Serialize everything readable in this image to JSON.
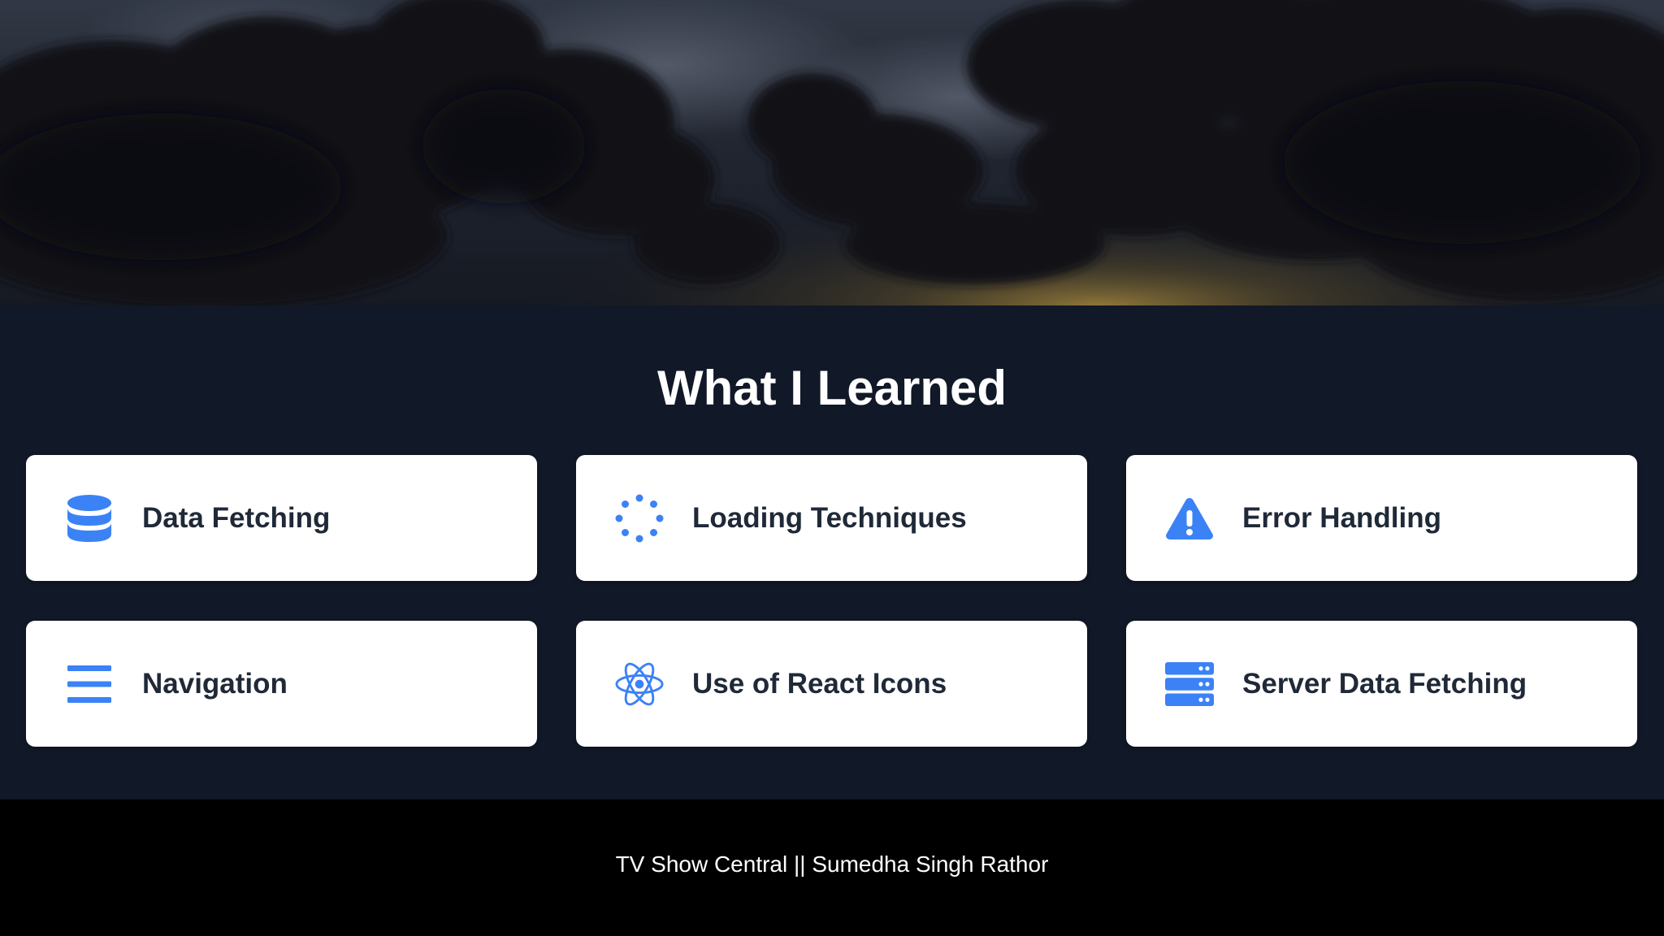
{
  "hero": {
    "image": "stormy-cloud-sky-banner"
  },
  "learned": {
    "title": "What I Learned",
    "cards": [
      {
        "label": "Data Fetching",
        "icon": "database-icon"
      },
      {
        "label": "Loading Techniques",
        "icon": "spinner-icon"
      },
      {
        "label": "Error Handling",
        "icon": "warning-triangle-icon"
      },
      {
        "label": "Navigation",
        "icon": "hamburger-menu-icon"
      },
      {
        "label": "Use of React Icons",
        "icon": "react-atom-icon"
      },
      {
        "label": "Server Data Fetching",
        "icon": "server-icon"
      }
    ]
  },
  "footer": {
    "text": "TV Show Central || Sumedha Singh Rathor"
  },
  "colors": {
    "section_bg": "#111827",
    "card_bg": "#ffffff",
    "icon_accent": "#3b82f6",
    "card_text": "#1f2937",
    "footer_bg": "#000000",
    "footer_text": "#ffffff"
  }
}
